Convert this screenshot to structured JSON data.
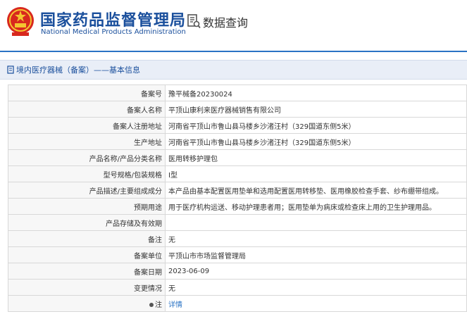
{
  "header": {
    "title_cn": "国家药品监督管理局",
    "title_en": "National Medical Products Administration",
    "query_title": "数据查询"
  },
  "section": {
    "title": "境内医疗器械（备案）——基本信息"
  },
  "rows": [
    {
      "label": "备案号",
      "value": "豫平械备20230024"
    },
    {
      "label": "备案人名称",
      "value": "平顶山康利来医疗器械销售有限公司"
    },
    {
      "label": "备案人注册地址",
      "value": "河南省平顶山市鲁山县马楼乡沙渚汪村（329国道东侧5米）"
    },
    {
      "label": "生产地址",
      "value": "河南省平顶山市鲁山县马楼乡沙渚汪村（329国道东侧5米）"
    },
    {
      "label": "产品名称/产品分类名称",
      "value": "医用转移护理包"
    },
    {
      "label": "型号规格/包装规格",
      "value": "I型"
    },
    {
      "label": "产品描述/主要组成成分",
      "value": "本产品由基本配置医用垫单和选用配置医用转移垫、医用橡胶检查手套、纱布绷带组成。"
    },
    {
      "label": "预期用途",
      "value": "用于医疗机构运送、移动护理患者用；医用垫单为病床或检查床上用的卫生护理用品。"
    },
    {
      "label": "产品存储及有效期",
      "value": ""
    },
    {
      "label": "备注",
      "value": "无"
    },
    {
      "label": "备案单位",
      "value": "平顶山市市场监督管理局"
    },
    {
      "label": "备案日期",
      "value": "2023-06-09"
    },
    {
      "label": "变更情况",
      "value": "无"
    },
    {
      "label": "注",
      "value": "详情"
    }
  ]
}
